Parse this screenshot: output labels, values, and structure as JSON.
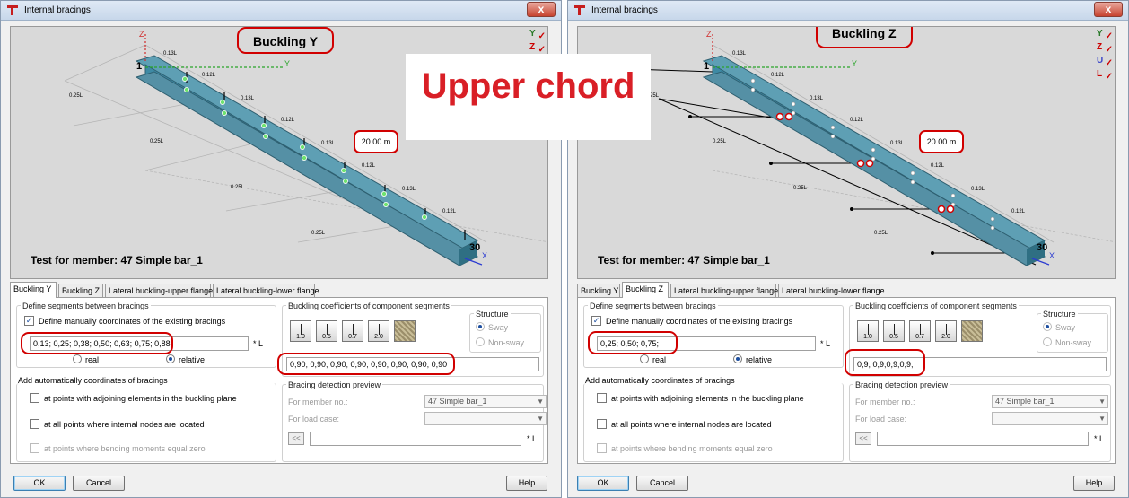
{
  "annotation": {
    "text": "Upper chord",
    "color": "#d91f26"
  },
  "highlight_color": "#d10000",
  "windows": [
    {
      "title": "Internal bracings",
      "close_label": "x",
      "preview": {
        "case_title": "Buckling Y",
        "test_label": "Test for member: 47 Simple bar_1",
        "length_label": "20.00  m",
        "node_start": "1",
        "node_end": "30",
        "axis_labels": {
          "z": "Z",
          "y": "Y",
          "x": "X"
        },
        "side_icons": [
          "Y",
          "Z"
        ],
        "upper_labels": [
          "0.13L",
          "0.12L",
          "0.13L",
          "0.12L",
          "0.13L",
          "0.12L",
          "0.13L",
          "0.12L"
        ],
        "lower_labels": [
          "0.25L",
          "0.25L",
          "0.25L",
          "0.25L"
        ]
      },
      "tabs": [
        "Buckling Y",
        "Buckling Z",
        "Lateral buckling-upper flange",
        "Lateral buckling-lower flange"
      ],
      "active_tab": 0,
      "define": {
        "group_title": "Define segments between bracings",
        "manual_label": "Define manually coordinates of the existing bracings",
        "manual_checked": "✓",
        "coords_value": "0,13; 0,25; 0,38; 0,50; 0,63; 0,75; 0,88",
        "unit": "* L",
        "real_label": "real",
        "relative_label": "relative"
      },
      "auto": {
        "title": "Add automatically coordinates of bracings",
        "opt1": "at points with adjoining elements in the buckling plane",
        "opt2": "at all points where internal nodes are located",
        "opt3": "at points where bending moments equal zero"
      },
      "coeff": {
        "title": "Buckling coefficients of component segments",
        "buttons": [
          "1.0",
          "0.5",
          "0.7",
          "2.0"
        ],
        "value": "0,90; 0,90; 0,90; 0,90; 0,90; 0,90; 0,90; 0,90"
      },
      "structure": {
        "title": "Structure",
        "sway": "Sway",
        "nonsway": "Non-sway"
      },
      "detection": {
        "title": "Bracing detection preview",
        "member_label": "For member no.:",
        "member_value": "47  Simple bar_1",
        "loadcase_label": "For load case:",
        "back": "<<",
        "unit": "* L"
      },
      "buttons": {
        "ok": "OK",
        "cancel": "Cancel",
        "help": "Help"
      }
    },
    {
      "title": "Internal bracings",
      "close_label": "x",
      "preview": {
        "case_title": "Buckling Z",
        "test_label": "Test for member: 47 Simple bar_1",
        "length_label": "20.00  m",
        "node_start": "1",
        "node_end": "30",
        "axis_labels": {
          "z": "Z",
          "y": "Y",
          "x": "X"
        },
        "side_icons": [
          "Y",
          "Z",
          "U",
          "L"
        ],
        "upper_labels": [
          "0.13L",
          "0.12L",
          "0.13L",
          "0.12L",
          "0.13L",
          "0.12L",
          "0.13L",
          "0.12L"
        ],
        "lower_labels": [
          "0.25L",
          "0.25L",
          "0.25L",
          "0.25L"
        ]
      },
      "tabs": [
        "Buckling Y",
        "Buckling Z",
        "Lateral buckling-upper flange",
        "Lateral buckling-lower flange"
      ],
      "active_tab": 1,
      "define": {
        "group_title": "Define segments between bracings",
        "manual_label": "Define manually coordinates of the existing bracings",
        "manual_checked": "✓",
        "coords_value": "0,25;  0,50;  0,75;",
        "unit": "* L",
        "real_label": "real",
        "relative_label": "relative"
      },
      "auto": {
        "title": "Add automatically coordinates of bracings",
        "opt1": "at points with adjoining elements in the buckling plane",
        "opt2": "at all points where internal nodes are located",
        "opt3": "at points where bending moments equal zero"
      },
      "coeff": {
        "title": "Buckling coefficients of component segments",
        "buttons": [
          "1.0",
          "0.5",
          "0.7",
          "2.0"
        ],
        "value": "0,9;  0,9;0,9;0,9;"
      },
      "structure": {
        "title": "Structure",
        "sway": "Sway",
        "nonsway": "Non-sway"
      },
      "detection": {
        "title": "Bracing detection preview",
        "member_label": "For member no.:",
        "member_value": "47  Simple bar_1",
        "loadcase_label": "For load case:",
        "back": "<<",
        "unit": "* L"
      },
      "buttons": {
        "ok": "OK",
        "cancel": "Cancel",
        "help": "Help"
      }
    }
  ]
}
